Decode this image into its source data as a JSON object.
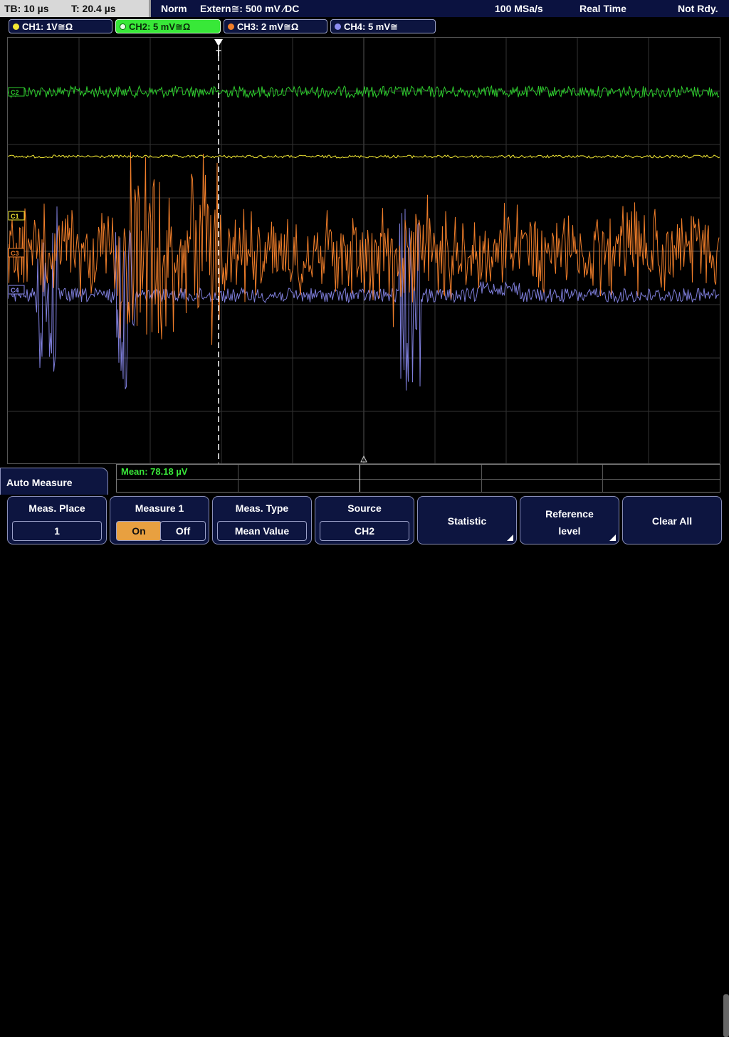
{
  "topbar": {
    "timebase": "TB: 10 µs",
    "trigger_pos": "T: 20.4 µs",
    "mode": "Norm",
    "trigger_source": "Extern≅: 500 mV ∕DC",
    "sample_rate": "100 MSa/s",
    "acq_mode": "Real Time",
    "status": "Not Rdy."
  },
  "channels": [
    {
      "label": "CH1: 1V≅Ω",
      "color": "#f2e833"
    },
    {
      "label": "CH2: 5 mV≅Ω",
      "color": "#2ecc2e"
    },
    {
      "label": "CH3: 2 mV≅Ω",
      "color": "#f07e2a"
    },
    {
      "label": "CH4: 5 mV≅",
      "color": "#8c8cf2"
    }
  ],
  "markers": {
    "c1": "C1",
    "c2": "C2",
    "c3": "C3",
    "c4": "C4",
    "trigger": "T"
  },
  "result": {
    "mean": "Mean: 78.18 µV"
  },
  "panel": {
    "title": "Auto Measure",
    "meas_place_label": "Meas. Place",
    "meas_place_value": "1",
    "measure_label": "Measure 1",
    "on_label": "On",
    "off_label": "Off",
    "meas_type_label": "Meas. Type",
    "meas_type_value": "Mean Value",
    "source_label": "Source",
    "source_value": "CH2",
    "statistic_label": "Statistic",
    "reference_label_1": "Reference",
    "reference_label_2": "level",
    "clear_label": "Clear All"
  }
}
